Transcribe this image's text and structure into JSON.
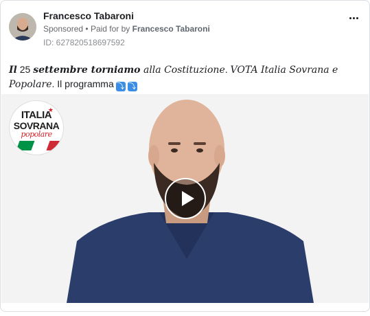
{
  "ad": {
    "page_name": "Francesco Tabaroni",
    "sponsored": "Sponsored",
    "separator": "•",
    "paid_for_prefix": "Paid for by",
    "paid_for_by": "Francesco Tabaroni",
    "id_line": "ID: 627820518697592"
  },
  "caption": {
    "part1": "Il",
    "part2": " 25 ",
    "part3": "settembre torniamo",
    "part4": " alla Costituzione",
    "part5": ". ",
    "part6": "VOTA Italia Sovrana e Popolare",
    "part7": ". Il programma",
    "emoji1": "⤵",
    "emoji2": "⤵"
  },
  "logo": {
    "line1": "ITALIA",
    "line2": "SOVRANA",
    "line3": "popolare",
    "star": "★",
    "flag_colors": [
      "#009246",
      "#ffffff",
      "#ce2b37"
    ]
  },
  "icons": {
    "more": "more-options-icon",
    "play": "play-icon"
  }
}
